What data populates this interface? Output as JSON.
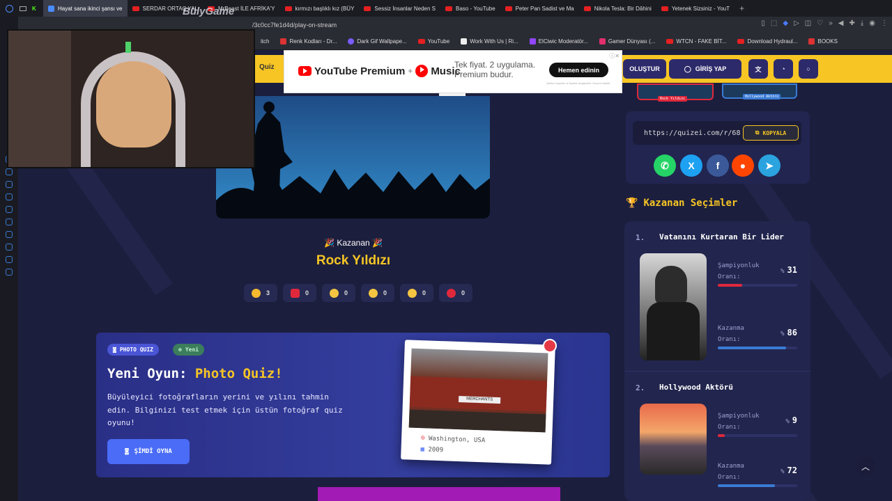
{
  "browser": {
    "tabs": [
      {
        "title": "Hayat sana ikinci şansı ve",
        "active": true
      },
      {
        "title": "SERDAR ORTAÇ YAL"
      },
      {
        "title": "MrBeast İLE AFRİKA'Y"
      },
      {
        "title": "kırmızı başlıklı kız (BÜY"
      },
      {
        "title": "Sessiz İnsanlar Neden S"
      },
      {
        "title": "Baso - YouTube"
      },
      {
        "title": "Peter Pan Sadist ve Ma"
      },
      {
        "title": "Nikola Tesla: Bir Dâhini"
      },
      {
        "title": "Yetenek Sizsiniz - YouT"
      }
    ],
    "new_tab": "+",
    "url": "/3c0cc7fe1d4d/play-on-stream",
    "bookmarks": [
      "itch",
      "Renk Kodları - Dr...",
      "Dark Gif Wallpape...",
      "YouTube",
      "Work With Us | Ri...",
      "ElCiwic Moderatör...",
      "Gamer Dünyası (...",
      "WTCN - FAKE BİT...",
      "Download Hydraul...",
      "BOOKS"
    ]
  },
  "overlay": {
    "watermark": "BülyGame"
  },
  "nav": {
    "quiz_label": "Quiz",
    "create_label": "OLUŞTUR",
    "login_label": "GİRİŞ YAP"
  },
  "ad": {
    "product": "YouTube Premium",
    "plus": "+",
    "music": "Music",
    "message_line1": "Tek fiyat. 2 uygulama.",
    "message_line2": "Premium budur.",
    "cta": "Hemen edinin",
    "fine_print": "Şartlar koşullar ve fiyatlar değişebilir. Geçerli olabilir."
  },
  "winner": {
    "label": "Kazanan",
    "name": "Rock Yıldızı",
    "reactions": [
      {
        "icon": "thumbs-up-icon",
        "count": "3",
        "color": "#f5b82e"
      },
      {
        "icon": "heart-icon",
        "count": "0",
        "color": "#e0283c"
      },
      {
        "icon": "laugh-icon",
        "count": "0",
        "color": "#f5c542"
      },
      {
        "icon": "wow-icon",
        "count": "0",
        "color": "#f5c542"
      },
      {
        "icon": "sad-icon",
        "count": "0",
        "color": "#f5c542"
      },
      {
        "icon": "angry-icon",
        "count": "0",
        "color": "#e0283c"
      }
    ]
  },
  "promo": {
    "badge": "PHOTO QUIZ",
    "new_badge": "Yeni",
    "title_prefix": "Yeni Oyun:",
    "title_highlight": "Photo Quiz!",
    "description": "Büyüleyici fotoğrafların yerini ve yılını tahmin edin. Bilginizi test etmek için üstün fotoğraf quiz oyunu!",
    "button": "ŞİMDİ OYNA",
    "location": "Washington, USA",
    "year": "2009",
    "sign_text": "MERCHANTS"
  },
  "share": {
    "url": "https://quizei.com/r/68",
    "copy_label": "KOPYALA",
    "socials": [
      {
        "name": "whatsapp",
        "glyph": "✆",
        "color": "#25d366"
      },
      {
        "name": "x",
        "glyph": "X",
        "color": "#1da1f2"
      },
      {
        "name": "facebook",
        "glyph": "f",
        "color": "#3b5998"
      },
      {
        "name": "reddit",
        "glyph": "●",
        "color": "#ff4500"
      },
      {
        "name": "telegram",
        "glyph": "➤",
        "color": "#2aa3df"
      }
    ]
  },
  "top_thumbs": {
    "left": "Rock Yıldızı",
    "right": "Hollywood Aktörü"
  },
  "winning_choices": {
    "heading": "Kazanan Seçimler",
    "entries": [
      {
        "rank": "1.",
        "title": "Vatanını Kurtaran Bir Lider",
        "champion_label_1": "Şampiyonluk",
        "champion_label_2": "Oranı:",
        "champion_pct_sign": "%",
        "champion_value": "31",
        "champion_fraction": 0.31,
        "win_label_1": "Kazanma",
        "win_label_2": "Oranı:",
        "win_pct_sign": "%",
        "win_value": "86",
        "win_fraction": 0.86
      },
      {
        "rank": "2.",
        "title": "Hollywood Aktörü",
        "champion_label_1": "Şampiyonluk",
        "champion_label_2": "Oranı:",
        "champion_pct_sign": "%",
        "champion_value": "9",
        "champion_fraction": 0.09,
        "win_label_1": "Kazanma",
        "win_label_2": "Oranı:",
        "win_pct_sign": "%",
        "win_value": "72",
        "win_fraction": 0.72
      }
    ]
  },
  "colors": {
    "accent": "#f7c624",
    "navy": "#1c1e3d",
    "red_bar": "#e0283c",
    "blue_bar": "#3a7bd5"
  }
}
